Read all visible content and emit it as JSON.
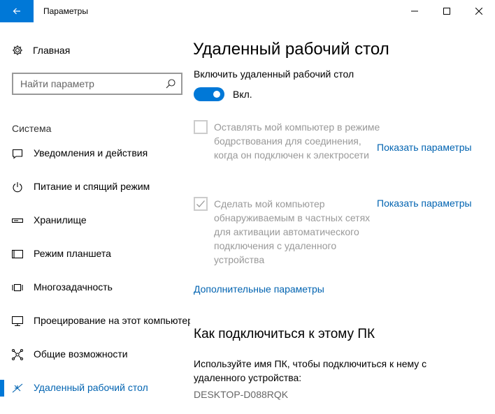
{
  "titlebar": {
    "title": "Параметры",
    "back": "back-arrow-icon",
    "minimize": "minimize-icon",
    "maximize": "maximize-icon",
    "close": "close-icon"
  },
  "sidebar": {
    "home_label": "Главная",
    "search_placeholder": "Найти параметр",
    "section_title": "Система",
    "items": [
      {
        "label": "Уведомления и действия",
        "icon": "notifications-icon"
      },
      {
        "label": "Питание и спящий режим",
        "icon": "power-icon"
      },
      {
        "label": "Хранилище",
        "icon": "storage-icon"
      },
      {
        "label": "Режим планшета",
        "icon": "tablet-mode-icon"
      },
      {
        "label": "Многозадачность",
        "icon": "multitasking-icon"
      },
      {
        "label": "Проецирование на этот компьютер",
        "icon": "projecting-icon"
      },
      {
        "label": "Общие возможности",
        "icon": "shared-experiences-icon"
      },
      {
        "label": "Удаленный рабочий стол",
        "icon": "remote-desktop-icon",
        "active": true
      }
    ]
  },
  "main": {
    "title": "Удаленный рабочий стол",
    "toggle_caption": "Включить удаленный рабочий стол",
    "toggle_state": "Вкл.",
    "toggle_on": true,
    "option1_text": "Оставлять мой компьютер в режиме бодрствования для соединения, когда он подключен к электросети",
    "option1_checked": false,
    "option1_link": "Показать параметры",
    "option2_text": "Сделать мой компьютер обнаруживаемым в частных сетях для активации автоматического подключения с удаленного устройства",
    "option2_checked": true,
    "option2_link": "Показать параметры",
    "advanced_link": "Дополнительные параметры",
    "section2_title": "Как подключиться к этому ПК",
    "section2_desc": "Используйте имя ПК, чтобы подключиться к нему с удаленного устройства:",
    "pc_name": "DESKTOP-D088RQK"
  },
  "colors": {
    "accent": "#0078d7",
    "link": "#0063b1",
    "disabled_text": "#999999"
  }
}
